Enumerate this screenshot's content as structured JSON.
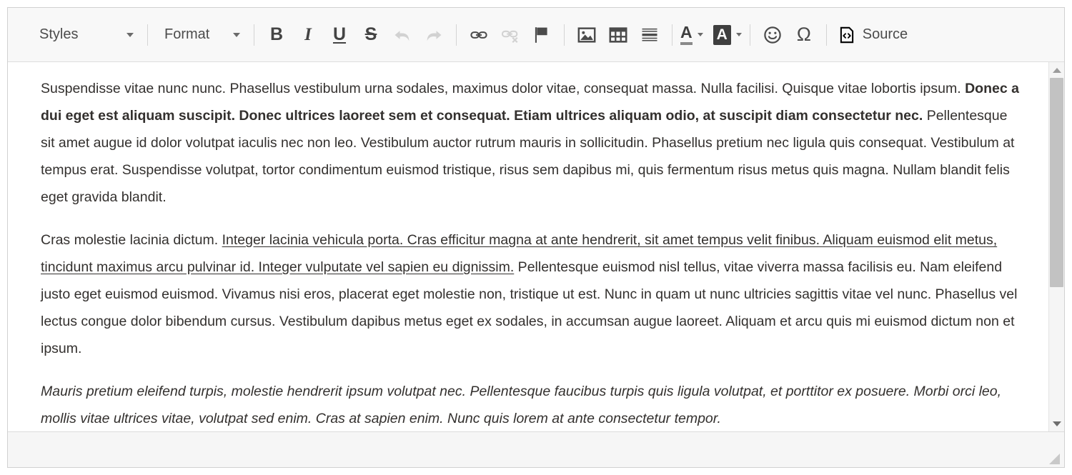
{
  "toolbar": {
    "styles_label": "Styles",
    "format_label": "Format",
    "bold_label": "B",
    "italic_label": "I",
    "underline_label": "U",
    "strike_label": "S",
    "text_color_letter": "A",
    "bg_color_letter": "A",
    "omega_label": "Ω",
    "source_label": "Source",
    "icons": {
      "styles_caret": "chevron-down-icon",
      "format_caret": "chevron-down-icon",
      "bold": "bold-icon",
      "italic": "italic-icon",
      "underline": "underline-icon",
      "strikethrough": "strikethrough-icon",
      "undo": "undo-arrow-icon",
      "redo": "redo-arrow-icon",
      "link": "link-icon",
      "unlink": "unlink-icon",
      "anchor": "flag-icon",
      "image": "image-icon",
      "table": "table-icon",
      "horizontal_rule": "horizontal-rule-icon",
      "text_color": "text-color-icon",
      "background_color": "background-color-icon",
      "smiley": "smiley-icon",
      "special_char": "omega-icon",
      "source": "source-code-icon"
    },
    "disabled": [
      "undo-arrow-icon",
      "redo-arrow-icon",
      "unlink-icon"
    ]
  },
  "document": {
    "paragraphs": [
      {
        "style": "normal",
        "runs": [
          {
            "format": "plain",
            "text": "Suspendisse vitae nunc nunc. Phasellus vestibulum urna sodales, maximus dolor vitae, consequat massa. Nulla facilisi. Quisque vitae lobortis ipsum. "
          },
          {
            "format": "bold",
            "text": "Donec a dui eget est aliquam suscipit. Donec ultrices laoreet sem et consequat. Etiam ultrices aliquam odio, at suscipit diam consectetur nec."
          },
          {
            "format": "plain",
            "text": " Pellentesque sit amet augue id dolor volutpat iaculis nec non leo. Vestibulum auctor rutrum mauris in sollicitudin. Phasellus pretium nec ligula quis consequat. Vestibulum at tempus erat. Suspendisse volutpat, tortor condimentum euismod tristique, risus sem dapibus mi, quis fermentum risus metus quis magna. Nullam blandit felis eget gravida blandit."
          }
        ]
      },
      {
        "style": "normal",
        "runs": [
          {
            "format": "plain",
            "text": "Cras molestie lacinia dictum. "
          },
          {
            "format": "underline",
            "text": "Integer lacinia vehicula porta. Cras efficitur magna at ante hendrerit, sit amet tempus velit finibus. Aliquam euismod elit metus, tincidunt maximus arcu pulvinar id. Integer vulputate vel sapien eu dignissim."
          },
          {
            "format": "plain",
            "text": " Pellentesque euismod nisl tellus, vitae viverra massa facilisis eu. Nam eleifend justo eget euismod euismod. Vivamus nisi eros, placerat eget molestie non, tristique ut est. Nunc in quam ut nunc ultricies sagittis vitae vel nunc. Phasellus vel lectus congue dolor bibendum cursus. Vestibulum dapibus metus eget ex sodales, in accumsan augue laoreet. Aliquam et arcu quis mi euismod dictum non et ipsum."
          }
        ]
      },
      {
        "style": "italic",
        "runs": [
          {
            "format": "plain",
            "text": "Mauris pretium eleifend turpis, molestie hendrerit ipsum volutpat nec. Pellentesque faucibus turpis quis ligula volutpat, et porttitor ex posuere. Morbi orci leo, mollis vitae ultrices vitae, volutpat sed enim. Cras at sapien enim. Nunc quis lorem at ante consectetur tempor."
          }
        ]
      }
    ]
  },
  "scrollbar": {
    "up_icon": "scroll-up-arrow-icon",
    "down_icon": "scroll-down-arrow-icon",
    "thumb_top_percent": 0,
    "thumb_height_percent": 62
  },
  "footer": {
    "resize_grip_icon": "resize-grip-icon"
  },
  "colors": {
    "toolbar_bg": "#f8f8f8",
    "border": "#d1d1d1",
    "text": "#33302e",
    "icon": "#4b4b4b",
    "icon_disabled": "#cccccc",
    "scroll_thumb": "#c2c2c2"
  }
}
